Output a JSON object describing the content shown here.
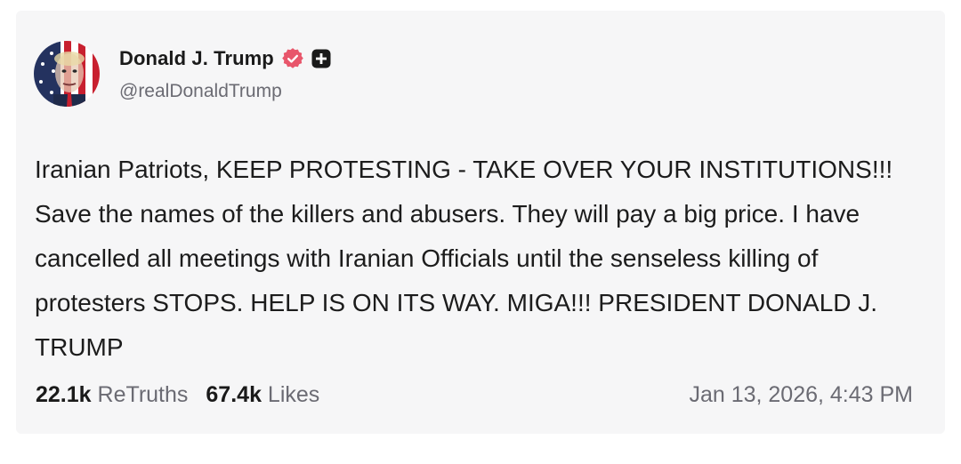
{
  "post": {
    "author": {
      "display_name": "Donald J. Trump",
      "handle": "@realDonaldTrump",
      "avatar_icon": "flag-portrait-avatar",
      "verified_icon": "verified-badge-icon",
      "verified_color": "#e8566b",
      "subscription_icon": "plus-badge-icon"
    },
    "text": "Iranian Patriots, KEEP PROTESTING - TAKE OVER YOUR INSTITUTIONS!!! Save the names of the killers and abusers. They will pay a big price. I have cancelled all meetings with Iranian Officials until the senseless killing of protesters STOPS. HELP IS ON ITS WAY. MIGA!!! PRESIDENT DONALD J. TRUMP",
    "stats": {
      "retruths_count": "22.1k",
      "retruths_label": "ReTruths",
      "likes_count": "67.4k",
      "likes_label": "Likes"
    },
    "timestamp": "Jan 13, 2026, 4:43 PM"
  }
}
